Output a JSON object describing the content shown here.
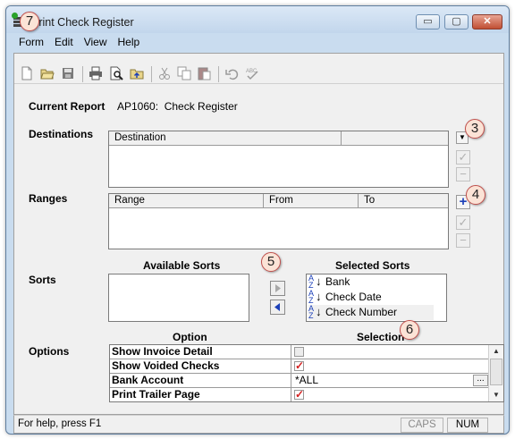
{
  "window": {
    "title": "Print Check Register",
    "buttons": {
      "minimize": "▭",
      "maximize": "▢",
      "close": "✕"
    }
  },
  "menu": [
    "Form",
    "Edit",
    "View",
    "Help"
  ],
  "toolbar": [
    "new-icon",
    "open-icon",
    "save-icon",
    "print-icon",
    "print-preview-icon",
    "export-icon",
    "cut-icon",
    "copy-icon",
    "paste-icon",
    "undo-icon",
    "spell-check-icon"
  ],
  "current_report": {
    "label": "Current Report",
    "value": "AP1060:  Check Register"
  },
  "destinations": {
    "label": "Destinations",
    "columns": [
      "Destination",
      ""
    ]
  },
  "ranges": {
    "label": "Ranges",
    "columns": [
      "Range",
      "From",
      "To"
    ]
  },
  "sorts": {
    "label": "Sorts",
    "available_label": "Available Sorts",
    "selected_label": "Selected Sorts",
    "available": [],
    "selected": [
      "Bank",
      "Check Date",
      "Check Number"
    ],
    "sort_icon_letters": [
      "A",
      "Z"
    ]
  },
  "options": {
    "label": "Options",
    "option_header": "Option",
    "selection_header": "Selection",
    "rows": [
      {
        "name": "Show Invoice Detail",
        "type": "checkbox",
        "checked": false,
        "value": ""
      },
      {
        "name": "Show Voided Checks",
        "type": "checkbox",
        "checked": true,
        "value": ""
      },
      {
        "name": "Bank Account",
        "type": "text",
        "checked": false,
        "value": "*ALL"
      },
      {
        "name": "Print Trailer Page",
        "type": "checkbox",
        "checked": true,
        "value": ""
      }
    ],
    "ellipsis": "..."
  },
  "callouts": [
    "7",
    "3",
    "4",
    "5",
    "6"
  ],
  "status": {
    "help": "For help, press F1",
    "caps": "CAPS",
    "num": "NUM"
  },
  "colors": {
    "checkmark": "#d42020",
    "callout_border": "#c0504d",
    "callout_fill": "#fbe3d6",
    "plus": "#1b3fb8"
  }
}
